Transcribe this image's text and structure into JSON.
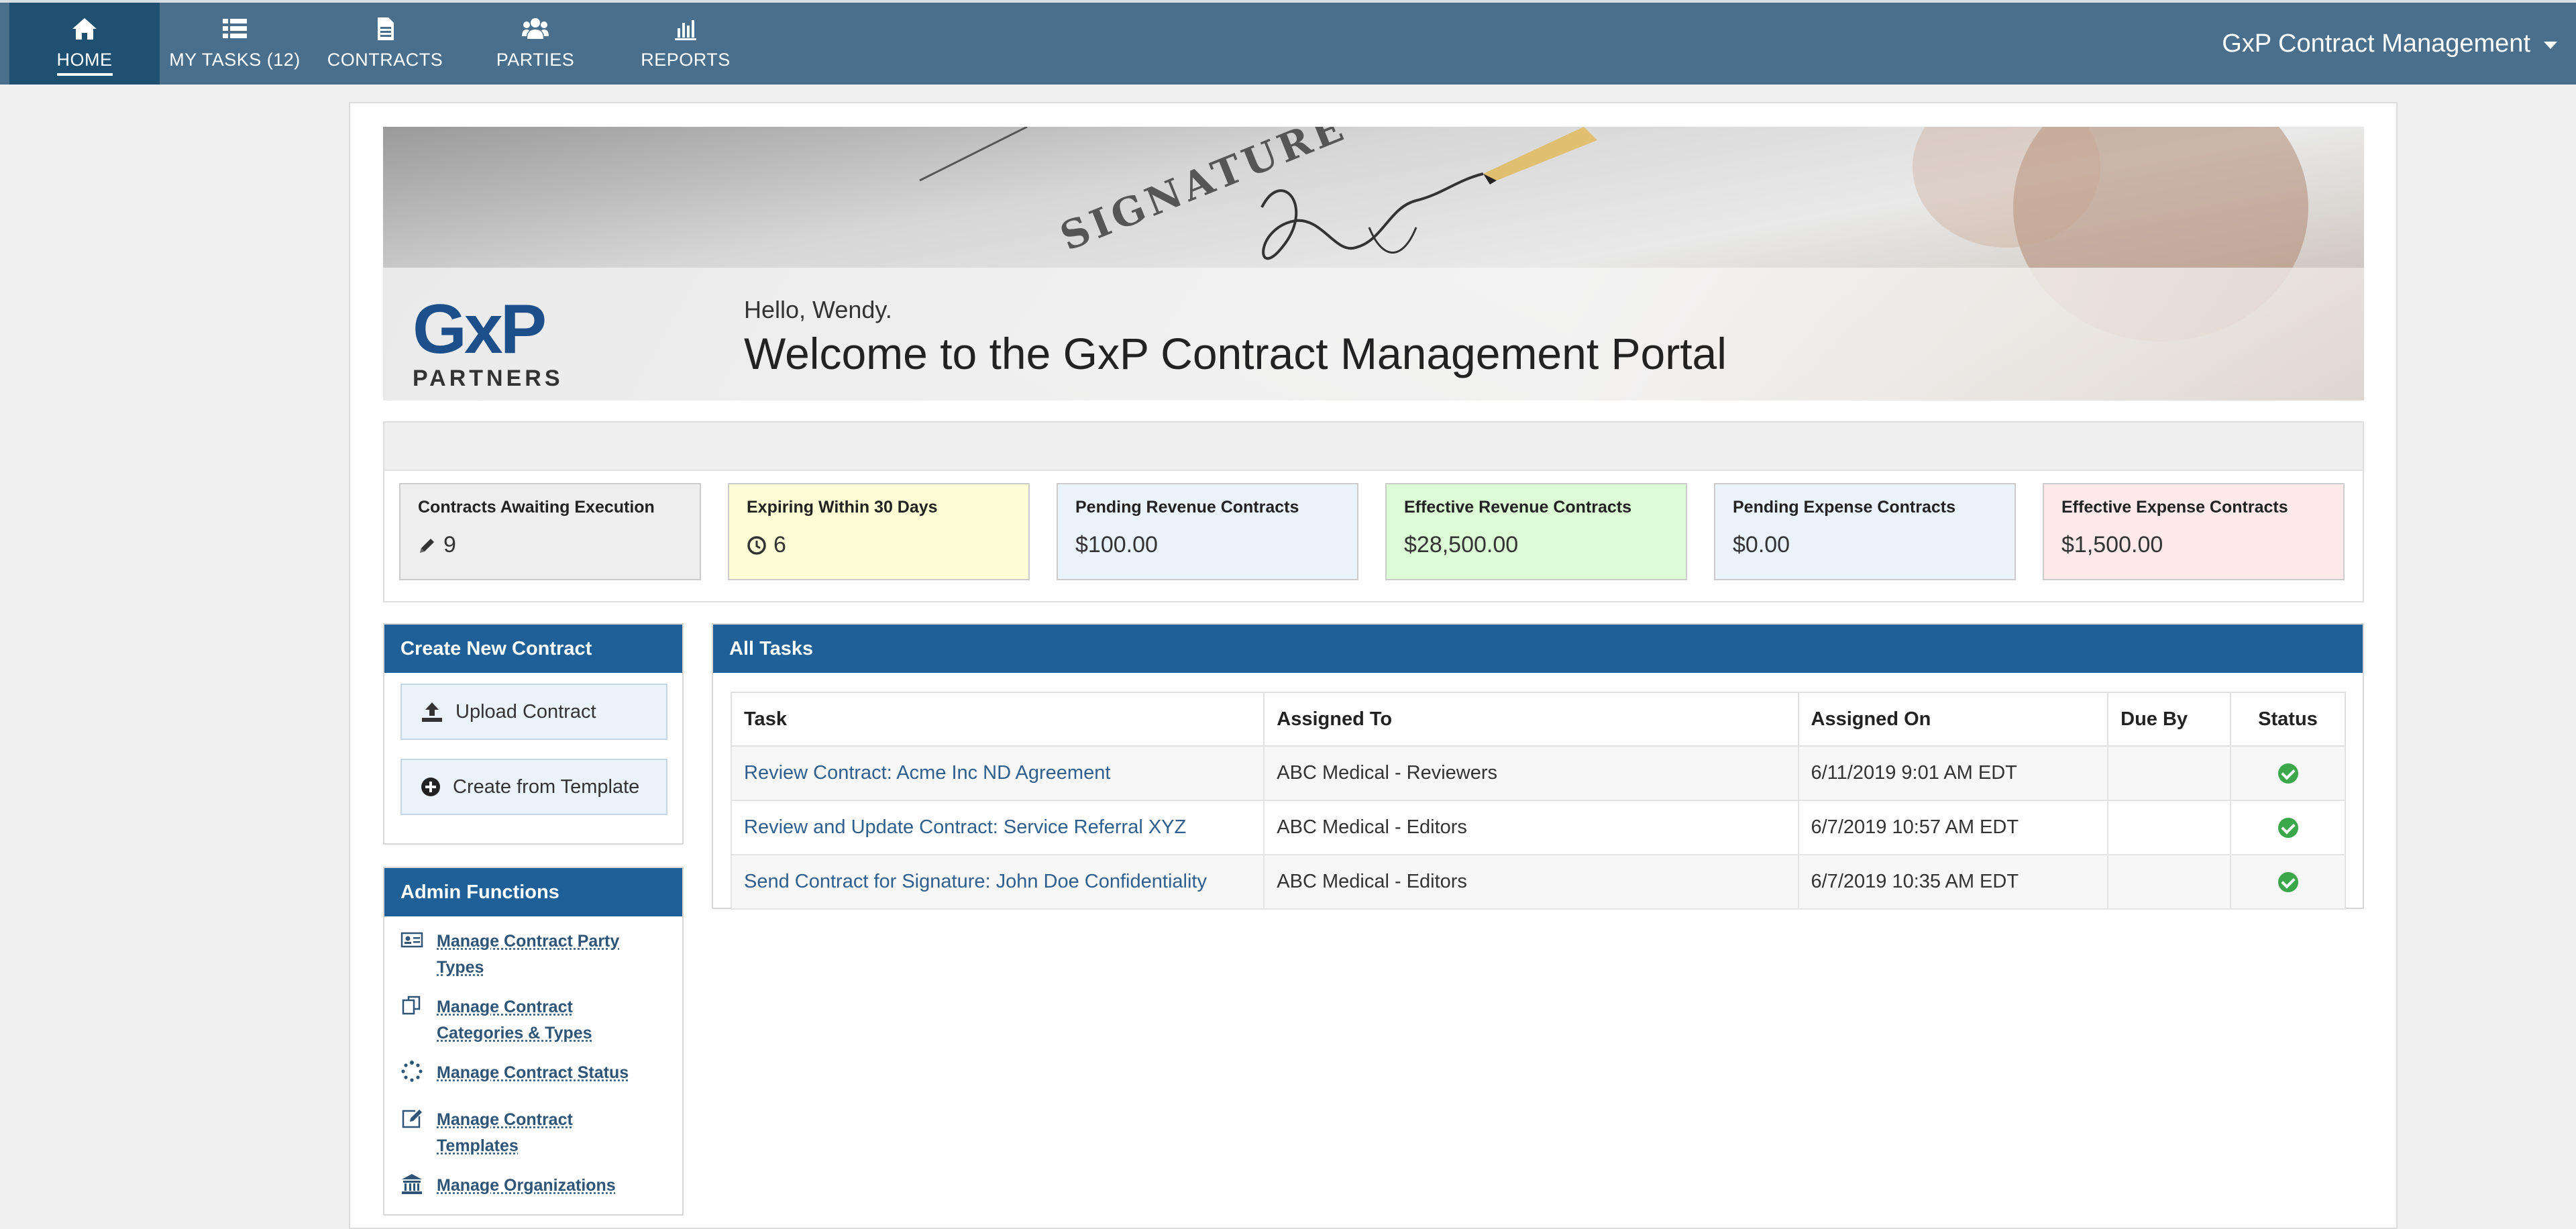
{
  "nav": {
    "items": [
      {
        "label": "HOME",
        "icon": "home-icon"
      },
      {
        "label": "MY TASKS (12)",
        "icon": "list-icon"
      },
      {
        "label": "CONTRACTS",
        "icon": "document-icon"
      },
      {
        "label": "PARTIES",
        "icon": "users-icon"
      },
      {
        "label": "REPORTS",
        "icon": "bar-chart-icon"
      }
    ],
    "brand": "GxP Contract Management"
  },
  "hero": {
    "greeting": "Hello, Wendy.",
    "title": "Welcome to the GxP Contract Management Portal",
    "signature_word": "SIGNATURE",
    "logo_main": "GxP",
    "logo_sub": "PARTNERS"
  },
  "stats": [
    {
      "title": "Contracts Awaiting Execution",
      "value": "9",
      "icon": "pencil-icon",
      "bg": "#eeeeee"
    },
    {
      "title": "Expiring Within 30 Days",
      "value": "6",
      "icon": "clock-icon",
      "bg": "#fefed6"
    },
    {
      "title": "Pending Revenue Contracts",
      "value": "$100.00",
      "bg": "#eaf2fc"
    },
    {
      "title": "Effective Revenue Contracts",
      "value": "$28,500.00",
      "bg": "#dcfcd6"
    },
    {
      "title": "Pending Expense Contracts",
      "value": "$0.00",
      "bg": "#eaf2fc"
    },
    {
      "title": "Effective Expense Contracts",
      "value": "$1,500.00",
      "bg": "#fde9e9"
    }
  ],
  "create_panel": {
    "title": "Create New Contract",
    "upload_label": "Upload Contract",
    "template_label": "Create from Template"
  },
  "admin_panel": {
    "title": "Admin Functions",
    "items": [
      {
        "line1": "Manage Contract Party",
        "line2": "Types",
        "icon": "id-card-icon"
      },
      {
        "line1": "Manage Contract",
        "line2": "Categories & Types",
        "icon": "copy-icon"
      },
      {
        "line1": "Manage Contract Status",
        "line2": "",
        "icon": "spinner-icon"
      },
      {
        "line1": "Manage Contract",
        "line2": "Templates",
        "icon": "edit-icon"
      },
      {
        "line1": "Manage Organizations",
        "line2": "",
        "icon": "bank-icon"
      }
    ]
  },
  "tasks": {
    "title": "All Tasks",
    "columns": [
      "Task",
      "Assigned To",
      "Assigned On",
      "Due By",
      "Status"
    ],
    "rows": [
      {
        "task": "Review Contract: Acme Inc ND Agreement",
        "assigned_to": "ABC Medical - Reviewers",
        "assigned_on": "6/11/2019 9:01 AM EDT",
        "due_by": "",
        "status": "complete"
      },
      {
        "task": "Review and Update Contract: Service Referral XYZ",
        "assigned_to": "ABC Medical - Editors",
        "assigned_on": "6/7/2019 10:57 AM EDT",
        "due_by": "",
        "status": "complete"
      },
      {
        "task": "Send Contract for Signature: John Doe Confidentiality",
        "assigned_to": "ABC Medical - Editors",
        "assigned_on": "6/7/2019 10:35 AM EDT",
        "due_by": "",
        "status": "complete"
      }
    ]
  },
  "colors": {
    "nav": "#4a6f8c",
    "nav_active": "#1f4f71",
    "panel_header": "#1f6098",
    "link": "#2e5f8e"
  }
}
